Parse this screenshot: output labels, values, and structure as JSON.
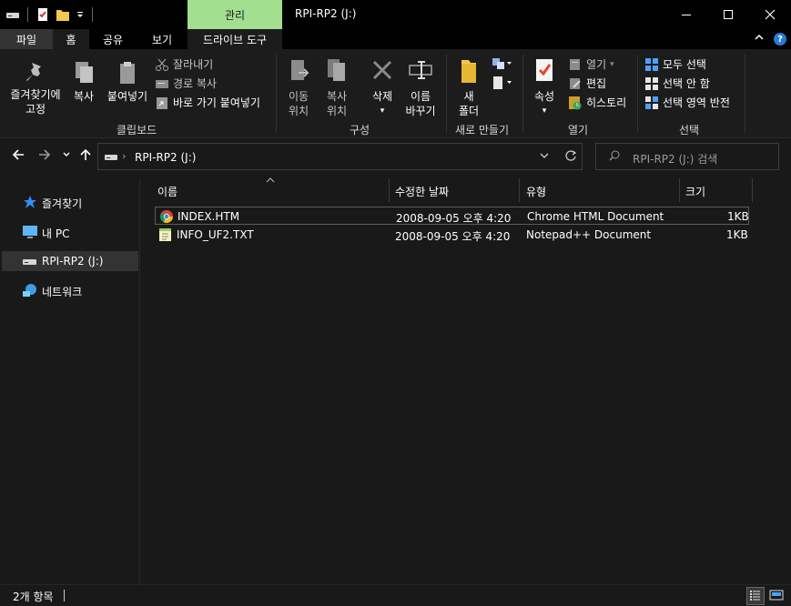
{
  "window": {
    "title": "RPI-RP2 (J:)",
    "context_tab": "관리",
    "buttons": {
      "minimize": "—",
      "maximize": "☐",
      "close": "✕"
    }
  },
  "tabs": [
    {
      "label": "파일"
    },
    {
      "label": "홈"
    },
    {
      "label": "공유"
    },
    {
      "label": "보기"
    },
    {
      "label": "드라이브 도구"
    }
  ],
  "ribbon": {
    "clipboard": {
      "pin_label_1": "즐겨찾기에",
      "pin_label_2": "고정",
      "copy": "복사",
      "paste": "붙여넣기",
      "cut": "잘라내기",
      "copy_path": "경로 복사",
      "paste_shortcut": "바로 가기 붙여넣기",
      "group": "클립보드"
    },
    "organize": {
      "move_1": "이동",
      "move_2": "위치",
      "copy_1": "복사",
      "copy_2": "위치",
      "delete": "삭제",
      "rename_1": "이름",
      "rename_2": "바꾸기",
      "group": "구성"
    },
    "new": {
      "folder_1": "새",
      "folder_2": "폴더",
      "group": "새로 만들기"
    },
    "open": {
      "properties": "속성",
      "open": "열기",
      "edit": "편집",
      "history": "히스토리",
      "group": "열기"
    },
    "select": {
      "all": "모두 선택",
      "none": "선택 안 함",
      "invert": "선택 영역 반전",
      "group": "선택"
    }
  },
  "address": {
    "path": "RPI-RP2 (J:)",
    "search_placeholder": "RPI-RP2 (J:) 검색"
  },
  "sidebar": {
    "items": [
      {
        "label": "즐겨찾기"
      },
      {
        "label": "내 PC"
      },
      {
        "label": "RPI-RP2 (J:)"
      },
      {
        "label": "네트워크"
      }
    ]
  },
  "columns": [
    "이름",
    "수정한 날짜",
    "유형",
    "크기"
  ],
  "files": [
    {
      "name": "INDEX.HTM",
      "date": "2008-09-05 오후 4:20",
      "type": "Chrome HTML Document",
      "size": "1KB",
      "icon": "chrome-icon"
    },
    {
      "name": "INFO_UF2.TXT",
      "date": "2008-09-05 오후 4:20",
      "type": "Notepad++ Document",
      "size": "1KB",
      "icon": "notepad-icon"
    }
  ],
  "status": {
    "count": "2개 항목"
  },
  "colors": {
    "context_tab": "#a2e08f",
    "accent_blue": "#2a7bd6",
    "background": "#191919"
  }
}
